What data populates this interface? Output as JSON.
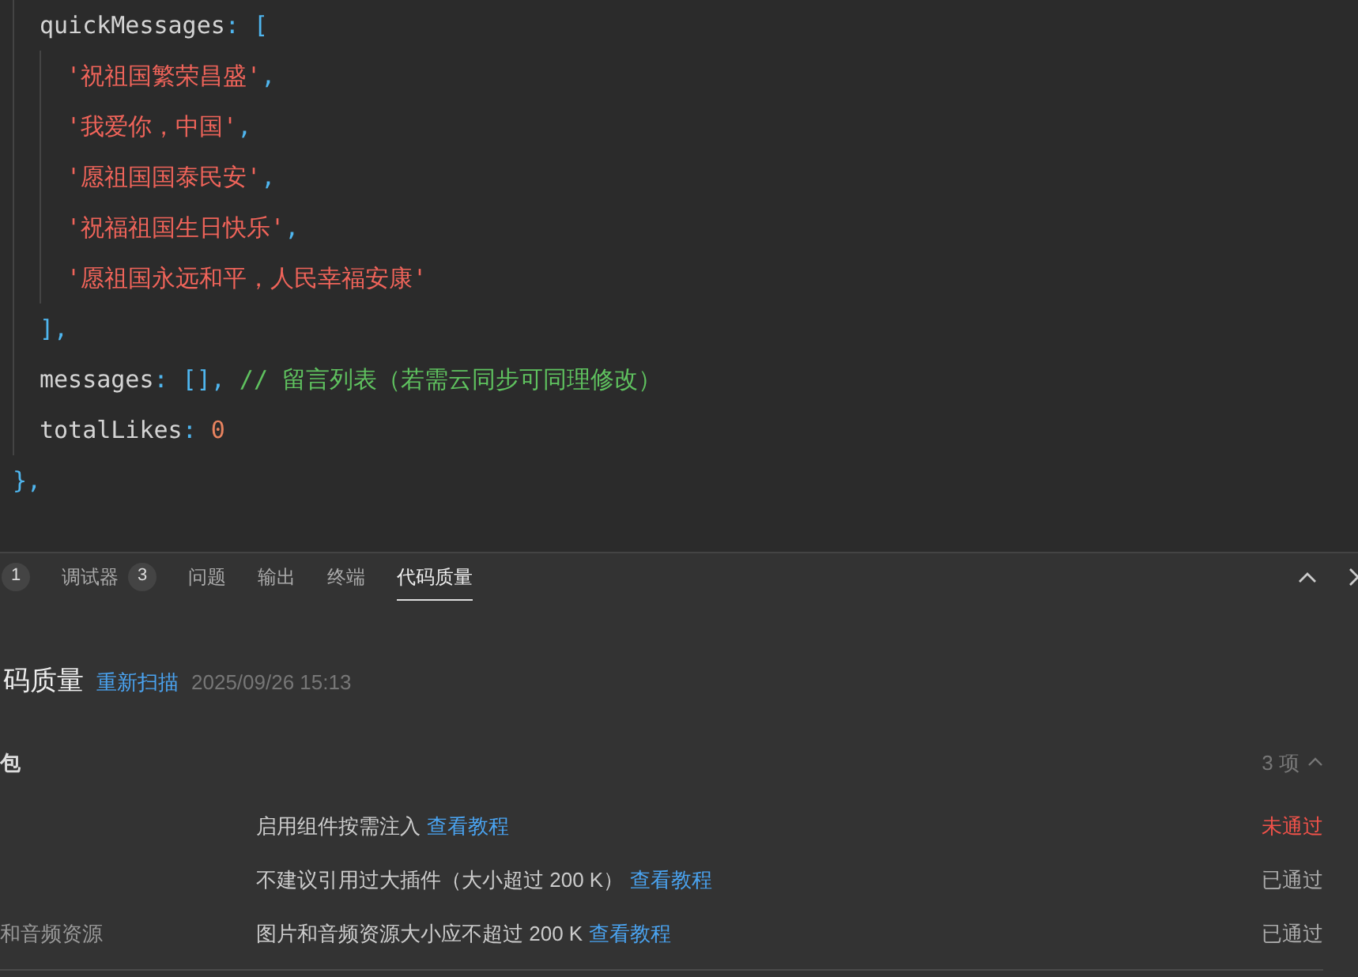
{
  "code": [
    {
      "children": [
        {
          "tokens": [
            {
              "kind": "ident",
              "text": "quickMessages"
            },
            {
              "kind": "punct",
              "text": ": ["
            }
          ],
          "children": [
            {
              "tokens": [
                {
                  "kind": "string",
                  "text": "'祝祖国繁荣昌盛'"
                },
                {
                  "kind": "punct",
                  "text": ","
                }
              ]
            },
            {
              "tokens": [
                {
                  "kind": "string",
                  "text": "'我爱你，中国'"
                },
                {
                  "kind": "punct",
                  "text": ","
                }
              ]
            },
            {
              "tokens": [
                {
                  "kind": "string",
                  "text": "'愿祖国国泰民安'"
                },
                {
                  "kind": "punct",
                  "text": ","
                }
              ]
            },
            {
              "tokens": [
                {
                  "kind": "string",
                  "text": "'祝福祖国生日快乐'"
                },
                {
                  "kind": "punct",
                  "text": ","
                }
              ]
            },
            {
              "tokens": [
                {
                  "kind": "string",
                  "text": "'愿祖国永远和平，人民幸福安康'"
                }
              ]
            }
          ]
        },
        {
          "tokens": [
            {
              "kind": "punct",
              "text": "],"
            }
          ]
        },
        {
          "tokens": [
            {
              "kind": "ident",
              "text": "messages"
            },
            {
              "kind": "punct",
              "text": ": [],"
            },
            {
              "kind": "comment",
              "text": " // 留言列表（若需云同步可同理修改）"
            }
          ]
        },
        {
          "tokens": [
            {
              "kind": "ident",
              "text": "totalLikes"
            },
            {
              "kind": "punct",
              "text": ": "
            },
            {
              "kind": "number",
              "text": "0"
            }
          ]
        }
      ]
    },
    {
      "tokens": [
        {
          "kind": "punct",
          "text": "},"
        }
      ]
    }
  ],
  "panel": {
    "tabs": [
      {
        "badge": "1",
        "selected": false
      },
      {
        "label": "调试器",
        "badge": "3",
        "selected": false
      },
      {
        "label": "问题",
        "selected": false
      },
      {
        "label": "输出",
        "selected": false
      },
      {
        "label": "终端",
        "selected": false
      },
      {
        "label": "代码质量",
        "selected": true
      }
    ],
    "title": "码质量",
    "rescan": "重新扫描",
    "time": "2025/09/26 15:13",
    "section": {
      "title": "包",
      "count": "3 项",
      "expanded": true,
      "rows": [
        {
          "description": "启用组件按需注入",
          "link": "查看教程",
          "status": "未通过",
          "passed": false
        },
        {
          "description": "不建议引用过大插件（大小超过 200 K）",
          "link": "查看教程",
          "status": "已通过",
          "passed": true
        },
        {
          "name": "和音频资源",
          "description": "图片和音频资源大小应不超过 200 K",
          "link": "查看教程",
          "status": "已通过",
          "passed": true
        }
      ]
    }
  }
}
